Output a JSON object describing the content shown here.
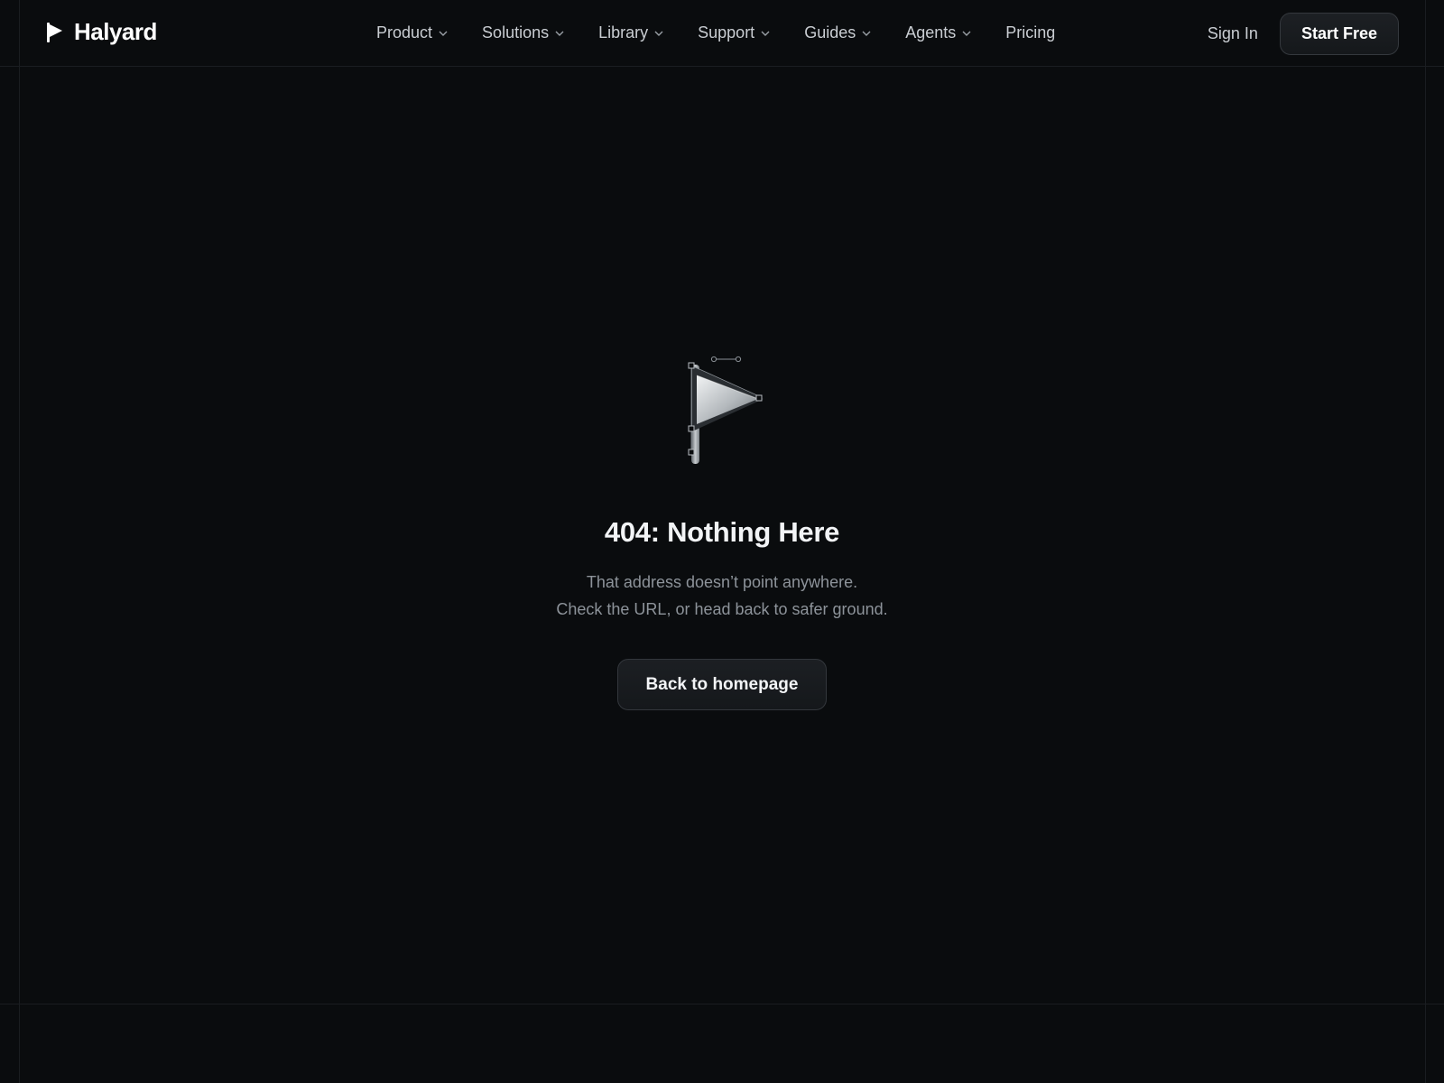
{
  "brand": {
    "name": "Halyard",
    "icon": "flag-icon"
  },
  "nav": {
    "items": [
      {
        "label": "Product",
        "has_dropdown": true
      },
      {
        "label": "Solutions",
        "has_dropdown": true
      },
      {
        "label": "Library",
        "has_dropdown": true
      },
      {
        "label": "Support",
        "has_dropdown": true
      },
      {
        "label": "Guides",
        "has_dropdown": true
      },
      {
        "label": "Agents",
        "has_dropdown": true
      },
      {
        "label": "Pricing",
        "has_dropdown": false
      }
    ]
  },
  "actions": {
    "sign_in": "Sign In",
    "start_free": "Start Free"
  },
  "error": {
    "illustration": "flag-icon",
    "title": "404: Nothing Here",
    "line1": "That address doesn’t point anywhere.",
    "line2": "Check the URL, or head back to safer ground.",
    "button": "Back to homepage"
  },
  "colors": {
    "background": "#0a0c0e",
    "text_primary": "#f2f4f6",
    "text_muted": "#8d939a",
    "button_border": "#33373c"
  }
}
